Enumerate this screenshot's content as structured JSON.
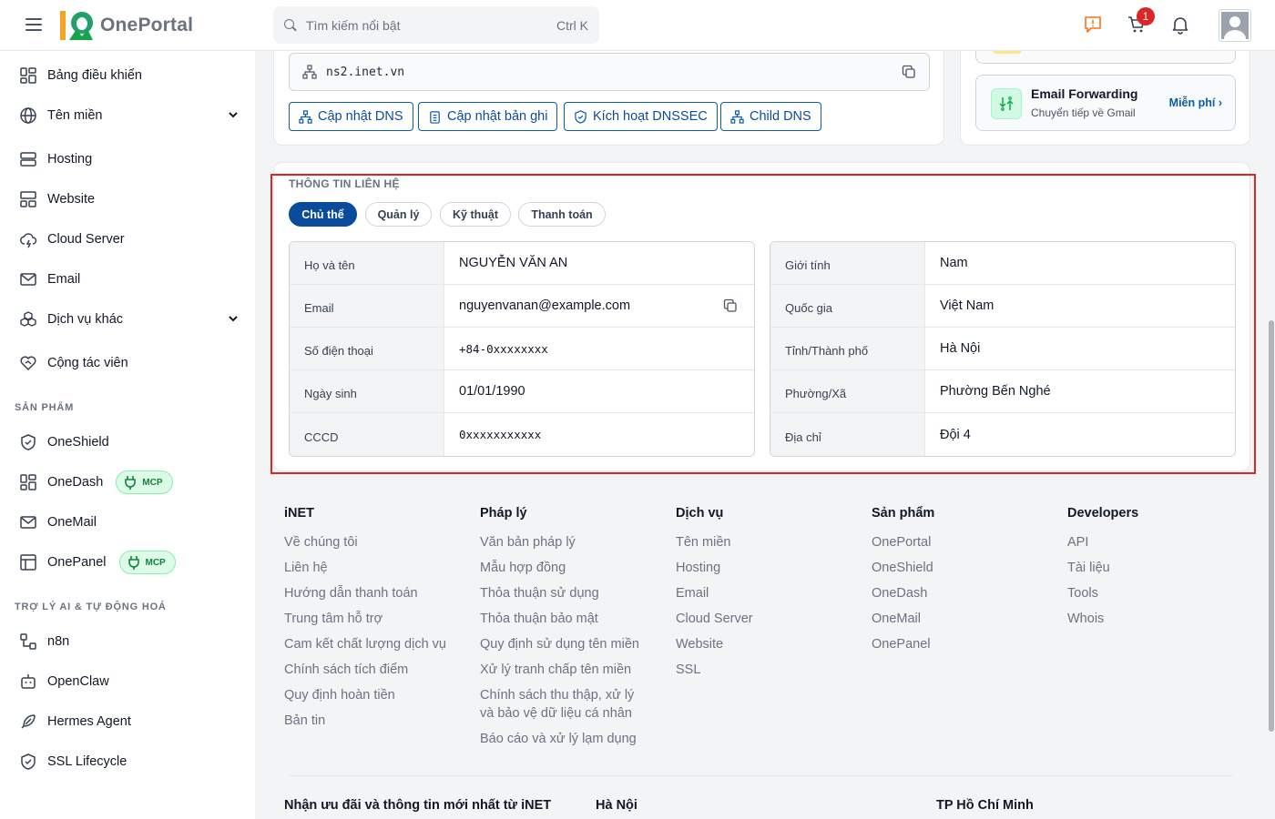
{
  "header": {
    "logo_text": "OnePortal",
    "search_placeholder": "Tìm kiếm nổi bật",
    "search_shortcut": "Ctrl K",
    "cart_count": "1"
  },
  "sidebar": {
    "items": [
      {
        "label": "Bảng điều khiển"
      },
      {
        "label": "Tên miền"
      },
      {
        "label": "Hosting"
      },
      {
        "label": "Website"
      },
      {
        "label": "Cloud Server"
      },
      {
        "label": "Email"
      },
      {
        "label": "Dịch vụ khác"
      },
      {
        "label": "Cộng tác viên"
      }
    ],
    "section_products": "SẢN PHẨM",
    "products": [
      {
        "label": "OneShield"
      },
      {
        "label": "OneDash",
        "badge": "MCP"
      },
      {
        "label": "OneMail"
      },
      {
        "label": "OnePanel",
        "badge": "MCP"
      }
    ],
    "section_ai": "TRỢ LÝ AI & TỰ ĐỘNG HOÁ",
    "ai": [
      {
        "label": "n8n"
      },
      {
        "label": "OpenClaw"
      },
      {
        "label": "Hermes Agent"
      },
      {
        "label": "SSL Lifecycle"
      }
    ]
  },
  "dns": {
    "nameserver": "ns2.inet.vn",
    "buttons": [
      "Cập nhật DNS",
      "Cập nhật bản ghi",
      "Kích hoạt DNSSEC",
      "Child DNS"
    ]
  },
  "email_forwarding": {
    "title": "Email Forwarding",
    "subtitle": "Chuyển tiếp về Gmail",
    "link": "Miễn phí ›"
  },
  "contact": {
    "title": "THÔNG TIN LIÊN HỆ",
    "tabs": [
      "Chủ thể",
      "Quản lý",
      "Kỹ thuật",
      "Thanh toán"
    ],
    "left": [
      {
        "label": "Họ và tên",
        "value": "NGUYỄN VĂN AN"
      },
      {
        "label": "Email",
        "value": "nguyenvanan@example.com"
      },
      {
        "label": "Số điện thoại",
        "value": "+84-0xxxxxxxx"
      },
      {
        "label": "Ngày sinh",
        "value": "01/01/1990"
      },
      {
        "label": "CCCD",
        "value": "0xxxxxxxxxxx"
      }
    ],
    "right": [
      {
        "label": "Giới tính",
        "value": "Nam"
      },
      {
        "label": "Quốc gia",
        "value": "Việt Nam"
      },
      {
        "label": "Tỉnh/Thành phố",
        "value": "Hà Nội"
      },
      {
        "label": "Phường/Xã",
        "value": "Phường Bến Nghé"
      },
      {
        "label": "Địa chỉ",
        "value": "Đội 4"
      }
    ]
  },
  "footer": {
    "columns": [
      {
        "title": "iNET",
        "links": [
          "Về chúng tôi",
          "Liên hệ",
          "Hướng dẫn thanh toán",
          "Trung tâm hỗ trợ",
          "Cam kết chất lượng dịch vụ",
          "Chính sách tích điểm",
          "Quy định hoàn tiền",
          "Bản tin"
        ]
      },
      {
        "title": "Pháp lý",
        "links": [
          "Văn bản pháp lý",
          "Mẫu hợp đồng",
          "Thỏa thuận sử dụng",
          "Thỏa thuận bảo mật",
          "Quy định sử dụng tên miền",
          "Xử lý tranh chấp tên miền",
          "Chính sách thu thập, xử lý",
          "và bảo vệ dữ liệu cá nhân",
          "Báo cáo và xử lý lạm dụng"
        ]
      },
      {
        "title": "Dịch vụ",
        "links": [
          "Tên miền",
          "Hosting",
          "Email",
          "Cloud Server",
          "Website",
          "SSL"
        ]
      },
      {
        "title": "Sản phẩm",
        "links": [
          "OnePortal",
          "OneShield",
          "OneDash",
          "OneMail",
          "OnePanel"
        ]
      },
      {
        "title": "Developers",
        "links": [
          "API",
          "Tài liệu",
          "Tools",
          "Whois"
        ]
      }
    ],
    "newsletter": "Nhận ưu đãi và thông tin mới nhất từ iNET",
    "city1": "Hà Nội",
    "city2": "TP Hồ Chí Minh"
  }
}
